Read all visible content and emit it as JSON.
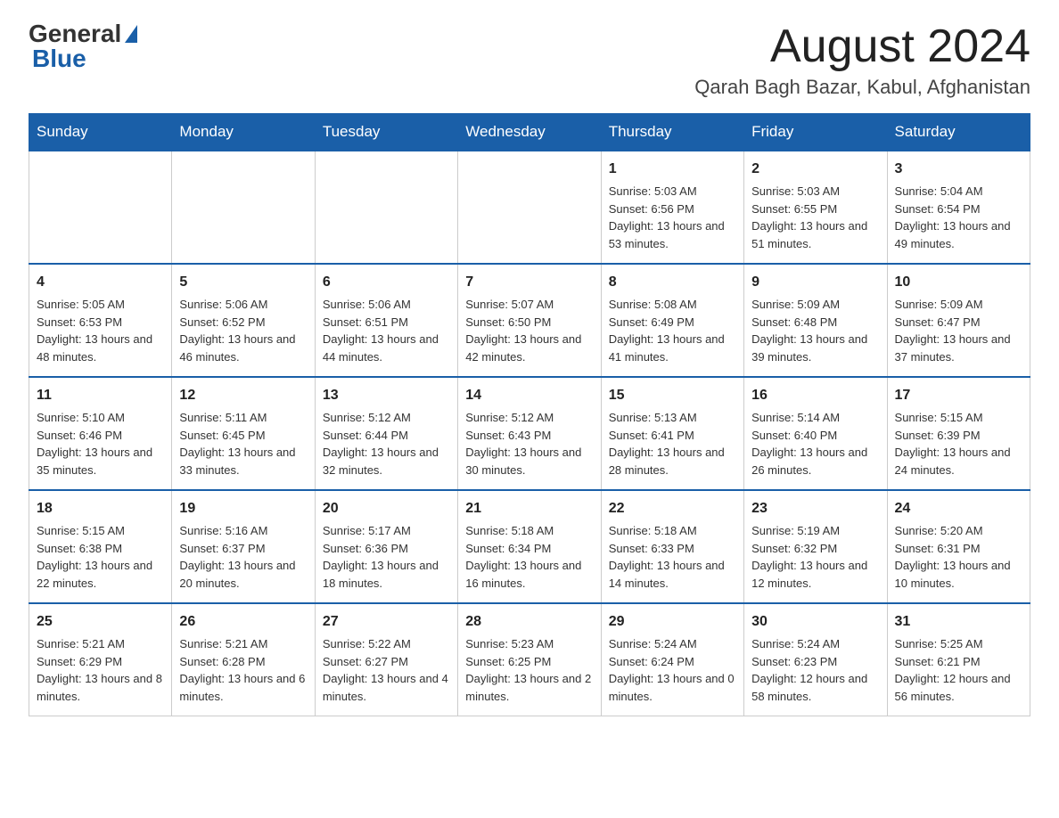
{
  "logo": {
    "general": "General",
    "blue": "Blue"
  },
  "title": {
    "month_year": "August 2024",
    "location": "Qarah Bagh Bazar, Kabul, Afghanistan"
  },
  "weekdays": [
    "Sunday",
    "Monday",
    "Tuesday",
    "Wednesday",
    "Thursday",
    "Friday",
    "Saturday"
  ],
  "weeks": [
    [
      {
        "day": "",
        "info": ""
      },
      {
        "day": "",
        "info": ""
      },
      {
        "day": "",
        "info": ""
      },
      {
        "day": "",
        "info": ""
      },
      {
        "day": "1",
        "info": "Sunrise: 5:03 AM\nSunset: 6:56 PM\nDaylight: 13 hours and 53 minutes."
      },
      {
        "day": "2",
        "info": "Sunrise: 5:03 AM\nSunset: 6:55 PM\nDaylight: 13 hours and 51 minutes."
      },
      {
        "day": "3",
        "info": "Sunrise: 5:04 AM\nSunset: 6:54 PM\nDaylight: 13 hours and 49 minutes."
      }
    ],
    [
      {
        "day": "4",
        "info": "Sunrise: 5:05 AM\nSunset: 6:53 PM\nDaylight: 13 hours and 48 minutes."
      },
      {
        "day": "5",
        "info": "Sunrise: 5:06 AM\nSunset: 6:52 PM\nDaylight: 13 hours and 46 minutes."
      },
      {
        "day": "6",
        "info": "Sunrise: 5:06 AM\nSunset: 6:51 PM\nDaylight: 13 hours and 44 minutes."
      },
      {
        "day": "7",
        "info": "Sunrise: 5:07 AM\nSunset: 6:50 PM\nDaylight: 13 hours and 42 minutes."
      },
      {
        "day": "8",
        "info": "Sunrise: 5:08 AM\nSunset: 6:49 PM\nDaylight: 13 hours and 41 minutes."
      },
      {
        "day": "9",
        "info": "Sunrise: 5:09 AM\nSunset: 6:48 PM\nDaylight: 13 hours and 39 minutes."
      },
      {
        "day": "10",
        "info": "Sunrise: 5:09 AM\nSunset: 6:47 PM\nDaylight: 13 hours and 37 minutes."
      }
    ],
    [
      {
        "day": "11",
        "info": "Sunrise: 5:10 AM\nSunset: 6:46 PM\nDaylight: 13 hours and 35 minutes."
      },
      {
        "day": "12",
        "info": "Sunrise: 5:11 AM\nSunset: 6:45 PM\nDaylight: 13 hours and 33 minutes."
      },
      {
        "day": "13",
        "info": "Sunrise: 5:12 AM\nSunset: 6:44 PM\nDaylight: 13 hours and 32 minutes."
      },
      {
        "day": "14",
        "info": "Sunrise: 5:12 AM\nSunset: 6:43 PM\nDaylight: 13 hours and 30 minutes."
      },
      {
        "day": "15",
        "info": "Sunrise: 5:13 AM\nSunset: 6:41 PM\nDaylight: 13 hours and 28 minutes."
      },
      {
        "day": "16",
        "info": "Sunrise: 5:14 AM\nSunset: 6:40 PM\nDaylight: 13 hours and 26 minutes."
      },
      {
        "day": "17",
        "info": "Sunrise: 5:15 AM\nSunset: 6:39 PM\nDaylight: 13 hours and 24 minutes."
      }
    ],
    [
      {
        "day": "18",
        "info": "Sunrise: 5:15 AM\nSunset: 6:38 PM\nDaylight: 13 hours and 22 minutes."
      },
      {
        "day": "19",
        "info": "Sunrise: 5:16 AM\nSunset: 6:37 PM\nDaylight: 13 hours and 20 minutes."
      },
      {
        "day": "20",
        "info": "Sunrise: 5:17 AM\nSunset: 6:36 PM\nDaylight: 13 hours and 18 minutes."
      },
      {
        "day": "21",
        "info": "Sunrise: 5:18 AM\nSunset: 6:34 PM\nDaylight: 13 hours and 16 minutes."
      },
      {
        "day": "22",
        "info": "Sunrise: 5:18 AM\nSunset: 6:33 PM\nDaylight: 13 hours and 14 minutes."
      },
      {
        "day": "23",
        "info": "Sunrise: 5:19 AM\nSunset: 6:32 PM\nDaylight: 13 hours and 12 minutes."
      },
      {
        "day": "24",
        "info": "Sunrise: 5:20 AM\nSunset: 6:31 PM\nDaylight: 13 hours and 10 minutes."
      }
    ],
    [
      {
        "day": "25",
        "info": "Sunrise: 5:21 AM\nSunset: 6:29 PM\nDaylight: 13 hours and 8 minutes."
      },
      {
        "day": "26",
        "info": "Sunrise: 5:21 AM\nSunset: 6:28 PM\nDaylight: 13 hours and 6 minutes."
      },
      {
        "day": "27",
        "info": "Sunrise: 5:22 AM\nSunset: 6:27 PM\nDaylight: 13 hours and 4 minutes."
      },
      {
        "day": "28",
        "info": "Sunrise: 5:23 AM\nSunset: 6:25 PM\nDaylight: 13 hours and 2 minutes."
      },
      {
        "day": "29",
        "info": "Sunrise: 5:24 AM\nSunset: 6:24 PM\nDaylight: 13 hours and 0 minutes."
      },
      {
        "day": "30",
        "info": "Sunrise: 5:24 AM\nSunset: 6:23 PM\nDaylight: 12 hours and 58 minutes."
      },
      {
        "day": "31",
        "info": "Sunrise: 5:25 AM\nSunset: 6:21 PM\nDaylight: 12 hours and 56 minutes."
      }
    ]
  ]
}
